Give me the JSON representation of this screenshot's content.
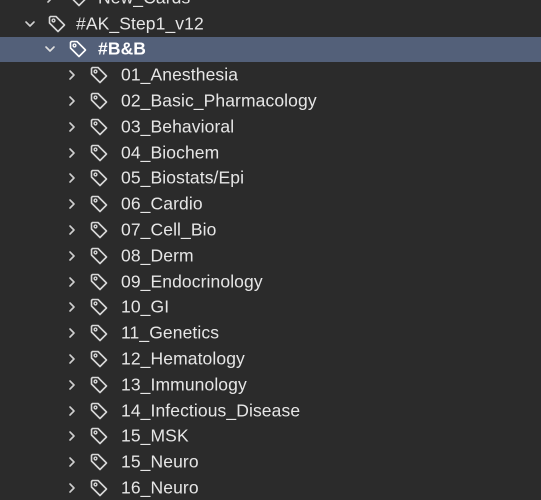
{
  "tree": {
    "prev_item": {
      "label": "New_Cards",
      "icon": "tag-icon",
      "expand": "chevron-right-icon"
    },
    "root": {
      "label": "#AK_Step1_v12",
      "icon": "tag-icon",
      "expand": "chevron-down-icon"
    },
    "group": {
      "label": "#B&B",
      "icon": "tag-icon",
      "expand": "chevron-down-icon",
      "selected": true,
      "highlight_color": "#536079"
    },
    "children": [
      {
        "label": "01_Anesthesia"
      },
      {
        "label": "02_Basic_Pharmacology"
      },
      {
        "label": "03_Behavioral"
      },
      {
        "label": "04_Biochem"
      },
      {
        "label": "05_Biostats/Epi"
      },
      {
        "label": "06_Cardio"
      },
      {
        "label": "07_Cell_Bio"
      },
      {
        "label": "08_Derm"
      },
      {
        "label": "09_Endocrinology"
      },
      {
        "label": "10_GI"
      },
      {
        "label": "11_Genetics"
      },
      {
        "label": "12_Hematology"
      },
      {
        "label": "13_Immunology"
      },
      {
        "label": "14_Infectious_Disease"
      },
      {
        "label": "15_MSK"
      },
      {
        "label": "15_Neuro"
      },
      {
        "label": "16_Neuro"
      }
    ]
  },
  "colors": {
    "background": "#2b2b2b",
    "text": "#e6e6e6",
    "icon": "#d8d8d8",
    "selection": "#536079"
  }
}
